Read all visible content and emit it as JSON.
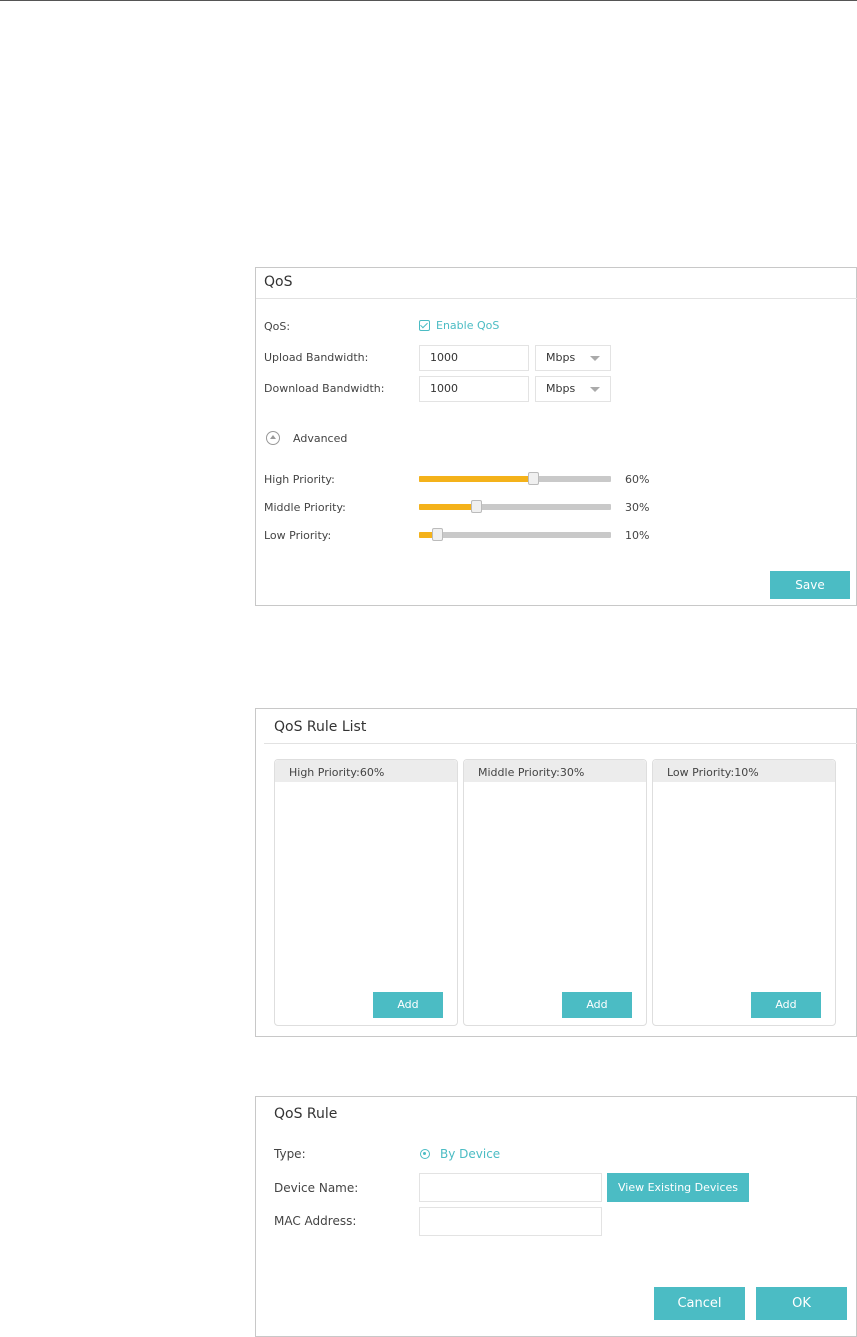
{
  "colors": {
    "accent": "#4bbcc4",
    "slider_fill": "#f4b21a",
    "slider_track": "#c9c9c9"
  },
  "qos_panel": {
    "title": "QoS",
    "qos_label": "QoS:",
    "enable_label": "Enable QoS",
    "enable_checked": true,
    "upload_label": "Upload Bandwidth:",
    "upload_value": "1000",
    "upload_unit": "Mbps",
    "download_label": "Download Bandwidth:",
    "download_value": "1000",
    "download_unit": "Mbps",
    "advanced_label": "Advanced",
    "priorities": [
      {
        "label": "High Priority:",
        "value_text": "60%",
        "percent": 60
      },
      {
        "label": "Middle Priority:",
        "value_text": "30%",
        "percent": 30
      },
      {
        "label": "Low Priority:",
        "value_text": "10%",
        "percent": 10
      }
    ],
    "save_label": "Save"
  },
  "rule_list": {
    "title": "QoS Rule List",
    "columns": [
      {
        "header": "High Priority:60%",
        "add_label": "Add"
      },
      {
        "header": "Middle Priority:30%",
        "add_label": "Add"
      },
      {
        "header": "Low Priority:10%",
        "add_label": "Add"
      }
    ]
  },
  "rule": {
    "title": "QoS Rule",
    "type_label": "Type:",
    "type_option": "By Device",
    "device_name_label": "Device Name:",
    "device_name_value": "",
    "view_devices_label": "View Existing Devices",
    "mac_label": "MAC Address:",
    "mac_value": "",
    "cancel_label": "Cancel",
    "ok_label": "OK"
  }
}
